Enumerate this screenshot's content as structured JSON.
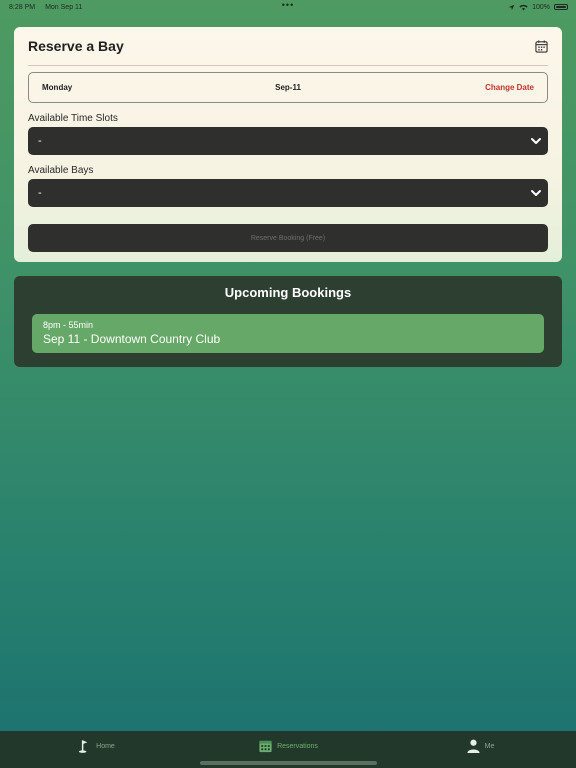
{
  "status_bar": {
    "time": "8:28 PM",
    "date": "Mon Sep 11",
    "dots": "•••",
    "battery": "100%"
  },
  "reserve": {
    "title": "Reserve a Bay",
    "day": "Monday",
    "date": "Sep-11",
    "change_date": "Change Date",
    "time_slots_label": "Available Time Slots",
    "time_slots_value": "-",
    "bays_label": "Available Bays",
    "bays_value": "-",
    "reserve_button": "Reserve Booking (Free)"
  },
  "upcoming": {
    "title": "Upcoming Bookings",
    "items": [
      {
        "time": "8pm - 55min",
        "place": "Sep 11 - Downtown Country Club"
      }
    ]
  },
  "tabs": [
    {
      "label": "Home",
      "icon": "golf-flag-icon"
    },
    {
      "label": "Reservations",
      "icon": "calendar-icon"
    },
    {
      "label": "Me",
      "icon": "person-icon"
    }
  ],
  "colors": {
    "accent_red": "#c0332b",
    "booking_green": "#66a867",
    "dark_panel": "#2d3f30",
    "tab_active": "#6bb06f"
  }
}
